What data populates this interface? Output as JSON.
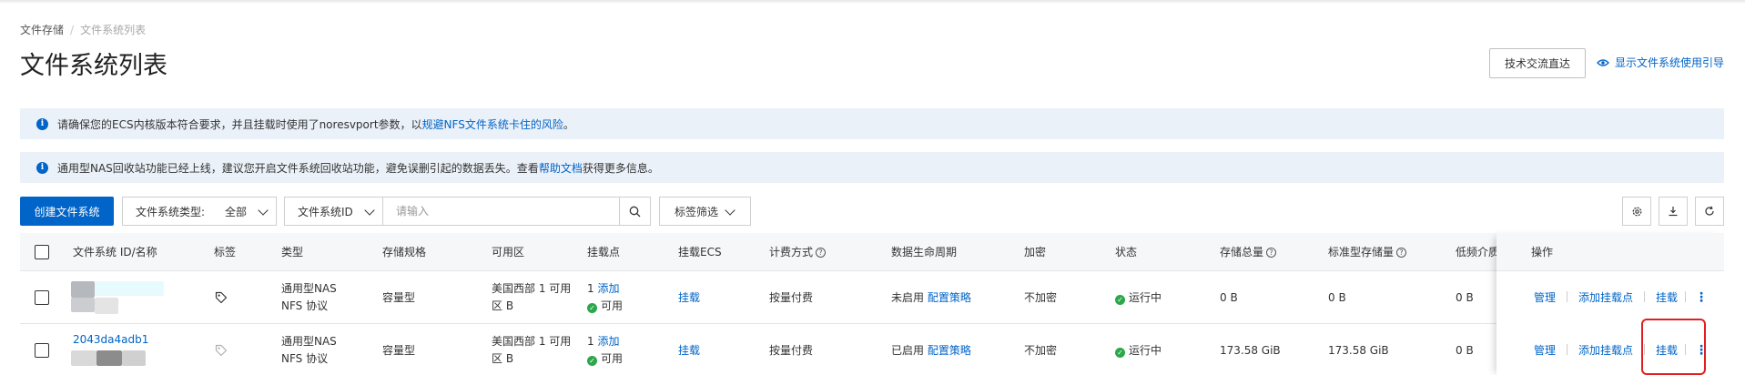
{
  "breadcrumb": {
    "parent": "文件存储",
    "current": "文件系统列表"
  },
  "title": "文件系统列表",
  "header_buttons": {
    "tech_exchange": "技术交流直达",
    "show_guide": "显示文件系统使用引导"
  },
  "notices": [
    {
      "text_before": "请确保您的ECS内核版本符合要求，并且挂载时使用了noresvport参数，以",
      "link": "规避NFS文件系统卡住的风险",
      "text_after": "。"
    },
    {
      "text_before": "通用型NAS回收站功能已经上线，建议您开启文件系统回收站功能，避免误删引起的数据丢失。查看",
      "link": "帮助文档",
      "text_after": "获得更多信息。"
    }
  ],
  "toolbar": {
    "create_button": "创建文件系统",
    "type_filter_label": "文件系统类型:",
    "type_filter_value": "全部",
    "id_select": "文件系统ID",
    "search_placeholder": "请输入",
    "tag_filter": "标签筛选"
  },
  "columns": {
    "id_name": "文件系统 ID/名称",
    "tags": "标签",
    "type": "类型",
    "spec": "存储规格",
    "zone": "可用区",
    "mount_points": "挂载点",
    "mount_ecs": "挂载ECS",
    "billing": "计费方式",
    "lifecycle": "数据生命周期",
    "encryption": "加密",
    "status": "状态",
    "total_storage": "存储总量",
    "standard_storage": "标准型存储量",
    "low_freq": "低频介质",
    "actions": "操作"
  },
  "rows": [
    {
      "id": "",
      "type_line1": "通用型NAS",
      "type_line2": "NFS 协议",
      "spec": "容量型",
      "zone_line1": "美国西部 1 可用",
      "zone_line2": "区 B",
      "mount_count": "1",
      "mount_add": "添加",
      "mount_status": "可用",
      "mount_ecs": "挂载",
      "billing": "按量付费",
      "lifecycle_status": "未启用",
      "lifecycle_link": "配置策略",
      "encryption": "不加密",
      "status": "运行中",
      "total_storage": "0 B",
      "standard_storage": "0 B",
      "low_freq": "0 B",
      "action_manage": "管理",
      "action_add_mount": "添加挂载点",
      "action_mount": "挂载"
    },
    {
      "id": "2043da4adb1",
      "type_line1": "通用型NAS",
      "type_line2": "NFS 协议",
      "spec": "容量型",
      "zone_line1": "美国西部 1 可用",
      "zone_line2": "区 B",
      "mount_count": "1",
      "mount_add": "添加",
      "mount_status": "可用",
      "mount_ecs": "挂载",
      "billing": "按量付费",
      "lifecycle_status": "已启用",
      "lifecycle_link": "配置策略",
      "encryption": "不加密",
      "status": "运行中",
      "total_storage": "173.58 GiB",
      "standard_storage": "173.58 GiB",
      "low_freq": "0 B",
      "action_manage": "管理",
      "action_add_mount": "添加挂载点",
      "action_mount": "挂载"
    }
  ],
  "colors": {
    "primary": "#0064c8",
    "notice_bg": "#ebf1f9",
    "status_green": "#2aa84a",
    "highlight": "#e02020"
  }
}
